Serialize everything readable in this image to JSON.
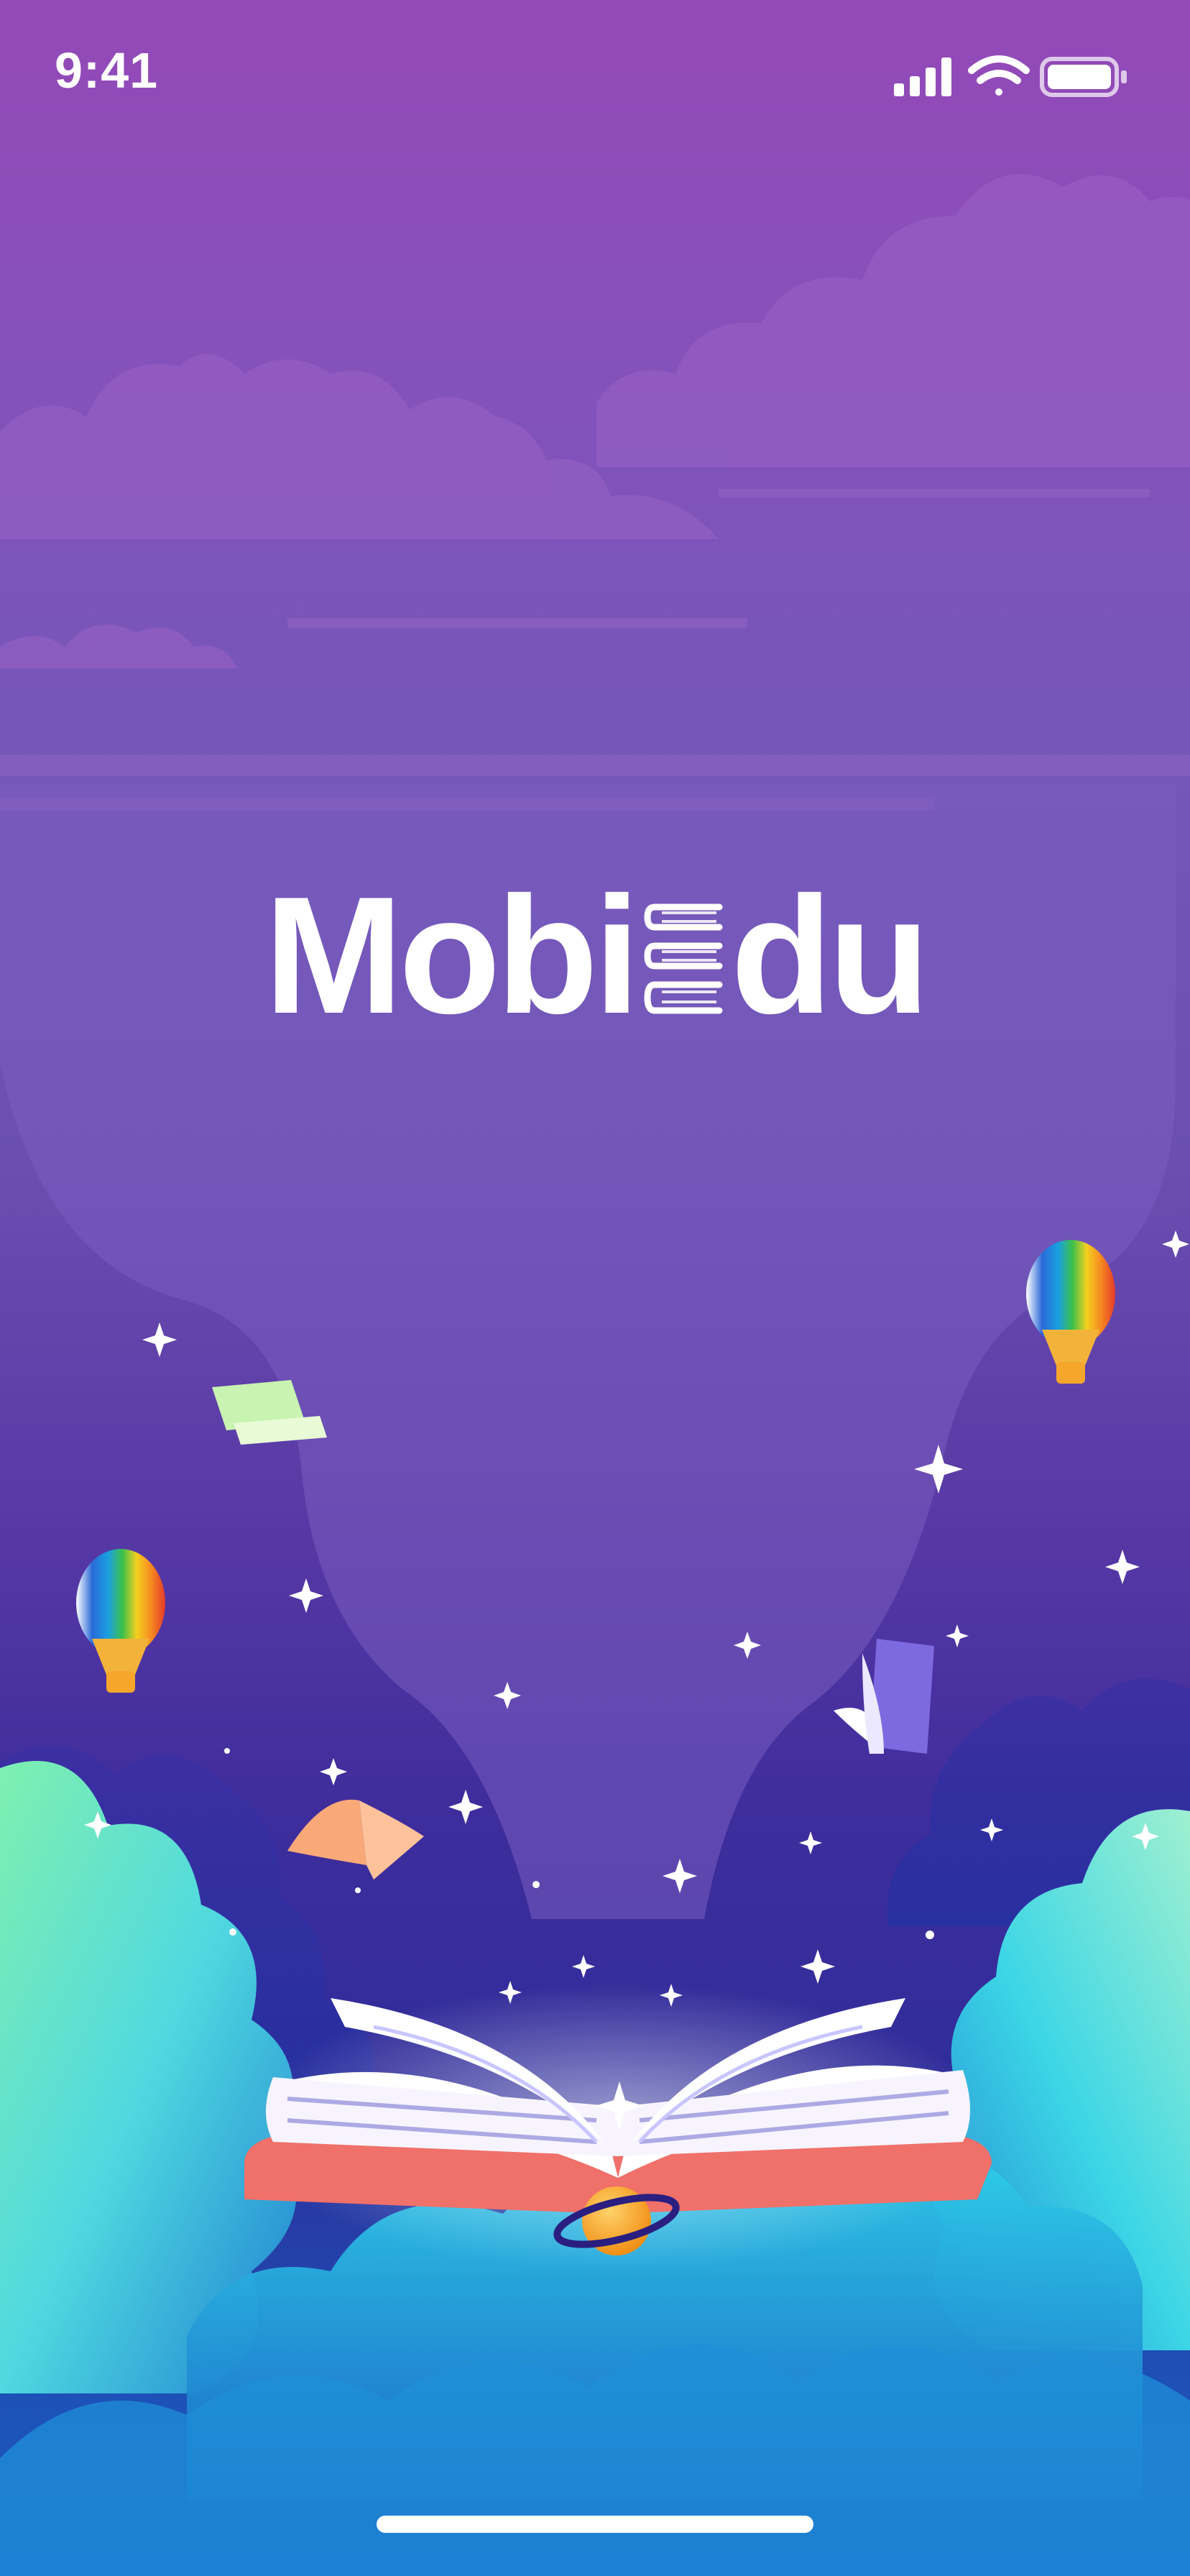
{
  "status_bar": {
    "time": "9:41",
    "icons": [
      "cellular-signal-icon",
      "wifi-icon",
      "battery-icon"
    ]
  },
  "splash": {
    "logo_part1": "Mobi",
    "logo_part2": "du"
  },
  "colors": {
    "top_background": "#9449b8",
    "mid_background": "#6a4fb0",
    "bottom_background": "#2d2d9a",
    "cloud_cyan": "#2fd3ea",
    "book_coral": "#f0706a",
    "planet_orange": "#f7a21b",
    "logo": "#ffffff"
  }
}
